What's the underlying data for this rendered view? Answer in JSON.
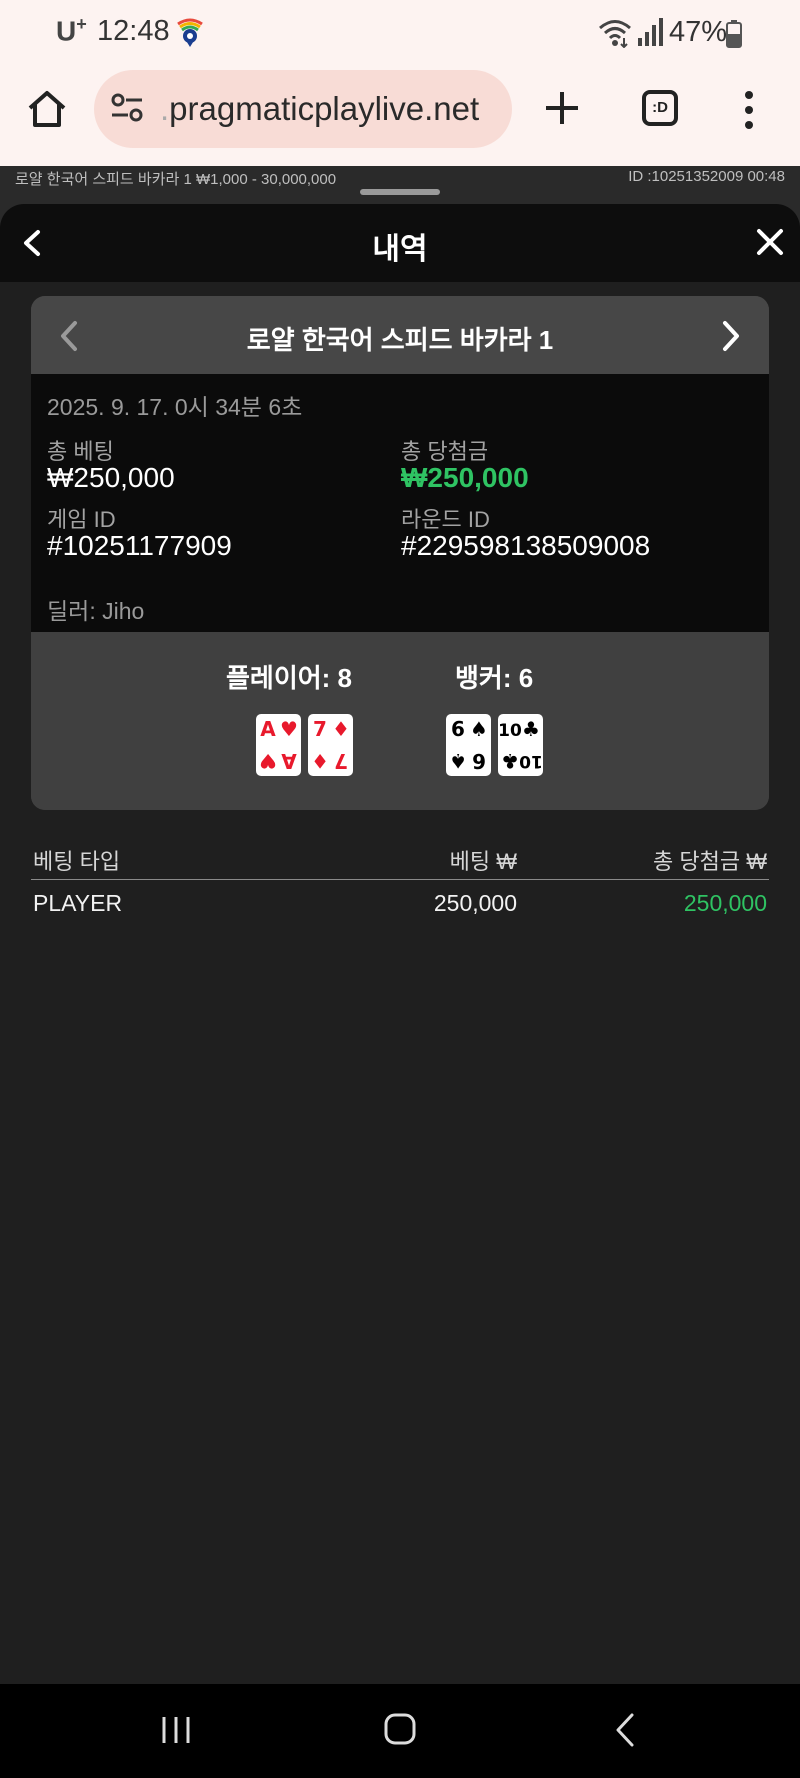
{
  "status_bar": {
    "carrier": "U",
    "carrier_sup": "+",
    "time": "12:48",
    "battery": "47%"
  },
  "browser": {
    "url_dim": ".",
    "url": "pragmaticplaylive.net",
    "tabs_label": ":D"
  },
  "underlay": {
    "left_text": "로얄 한국어 스피드 바카라 1 ₩1,000 - 30,000,000",
    "right_text": "ID :10251352009 00:48"
  },
  "modal": {
    "title": "내역"
  },
  "game": {
    "name": "로얄 한국어 스피드 바카라 1",
    "datetime": "2025. 9. 17. 0시 34분 6초",
    "total_bet_label": "총 베팅",
    "total_bet": "₩250,000",
    "total_win_label": "총 당첨금",
    "total_win": "₩250,000",
    "game_id_label": "게임 ID",
    "game_id": "#10251177909",
    "round_id_label": "라운드 ID",
    "round_id": "#229598138509008",
    "dealer": "딜러: Jiho",
    "player_label": "플레이어: 8",
    "banker_label": "뱅커: 6",
    "player_cards": [
      {
        "rank": "A",
        "suit": "♥",
        "color": "#e8192c"
      },
      {
        "rank": "7",
        "suit": "♦",
        "color": "#e8192c"
      }
    ],
    "banker_cards": [
      {
        "rank": "6",
        "suit": "♠",
        "color": "#000000"
      },
      {
        "rank": "10",
        "suit": "♣",
        "color": "#000000"
      }
    ]
  },
  "table": {
    "headers": [
      "베팅 타입",
      "베팅 ₩",
      "총 당첨금 ₩"
    ],
    "rows": [
      {
        "type": "PLAYER",
        "bet": "250,000",
        "win": "250,000"
      }
    ]
  },
  "colors": {
    "win_green": "#2fc363",
    "modal_bg": "#0d0d0d",
    "body_bg": "#1f1f1f"
  }
}
